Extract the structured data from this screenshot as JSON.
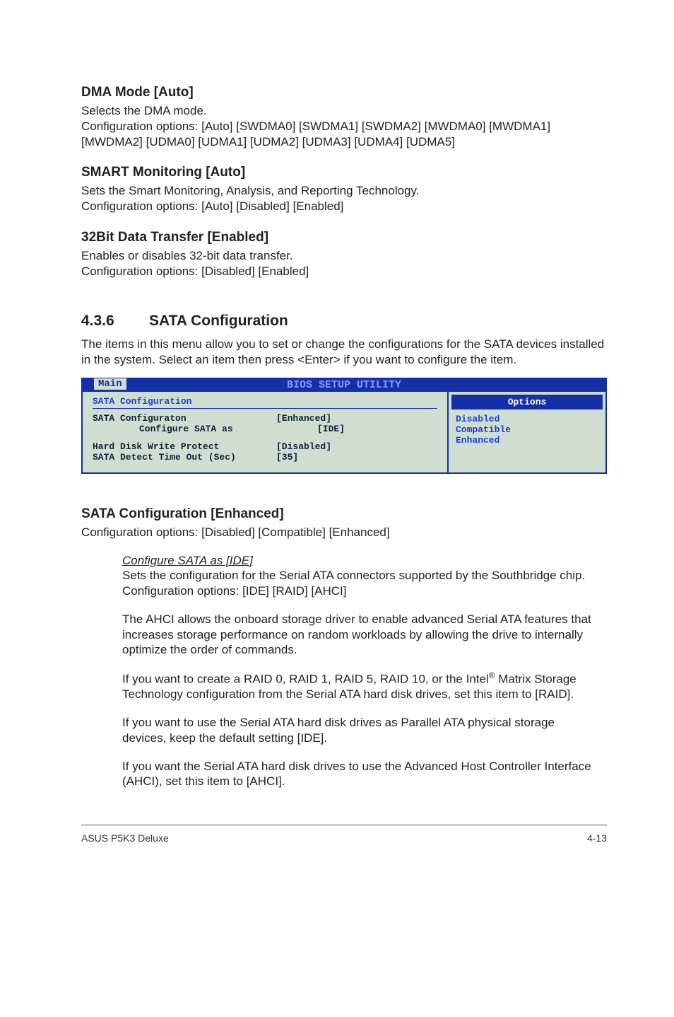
{
  "sections": {
    "dma": {
      "heading": "DMA Mode [Auto]",
      "p1": "Selects the DMA mode.",
      "p2": "Configuration options: [Auto] [SWDMA0] [SWDMA1] [SWDMA2] [MWDMA0] [MWDMA1] [MWDMA2] [UDMA0] [UDMA1] [UDMA2] [UDMA3] [UDMA4] [UDMA5]"
    },
    "smart": {
      "heading": "SMART Monitoring [Auto]",
      "p1": "Sets the Smart Monitoring, Analysis, and Reporting Technology.",
      "p2": "Configuration options: [Auto] [Disabled] [Enabled]"
    },
    "bit32": {
      "heading": "32Bit Data Transfer [Enabled]",
      "p1": "Enables or disables 32-bit data transfer.",
      "p2": "Configuration options: [Disabled] [Enabled]"
    },
    "sata_cfg": {
      "num": "4.3.6",
      "title": "SATA Configuration",
      "intro": "The items in this menu allow you to set or change the configurations for the SATA devices installed in the system. Select an item then press <Enter> if you want to configure the item."
    },
    "sata_enh": {
      "heading": "SATA Configuration [Enhanced]",
      "p1": "Configuration options: [Disabled] [Compatible] [Enhanced]"
    },
    "cfg_ide": {
      "heading": "Configure SATA as [IDE]",
      "p1": "Sets the configuration for the Serial ATA connectors supported by the Southbridge chip. Configuration options: [IDE] [RAID] [AHCI]",
      "p2": "The AHCI allows the onboard storage driver to enable advanced Serial ATA features that increases storage performance on random workloads by allowing the drive to internally optimize the order of commands.",
      "p3a": "If you want to create a RAID 0, RAID 1, RAID 5, RAID 10, or the Intel",
      "p3b": " Matrix Storage Technology configuration from the Serial ATA hard disk drives, set this item to [RAID].",
      "p4": "If you want to use the Serial ATA hard disk drives as Parallel ATA physical storage devices, keep the default setting [IDE].",
      "p5": "If you want the Serial ATA hard disk drives to use the Advanced Host Controller Interface (AHCI), set this item to [AHCI]."
    }
  },
  "bios": {
    "title": "BIOS SETUP UTILITY",
    "tab": "Main",
    "left_title": "SATA Configuration",
    "rows": [
      {
        "k": "SATA Configuraton",
        "v": "[Enhanced]",
        "indent": false
      },
      {
        "k": "Configure SATA as",
        "v": "[IDE]",
        "indent": true
      }
    ],
    "rows2": [
      {
        "k": "Hard Disk Write Protect",
        "v": "[Disabled]",
        "indent": false
      },
      {
        "k": "SATA Detect Time Out (Sec)",
        "v": "[35]",
        "indent": false
      }
    ],
    "right_header": "Options",
    "right_items": [
      "Disabled",
      "Compatible",
      "Enhanced"
    ]
  },
  "footer": {
    "left": "ASUS P5K3 Deluxe",
    "right": "4-13"
  }
}
